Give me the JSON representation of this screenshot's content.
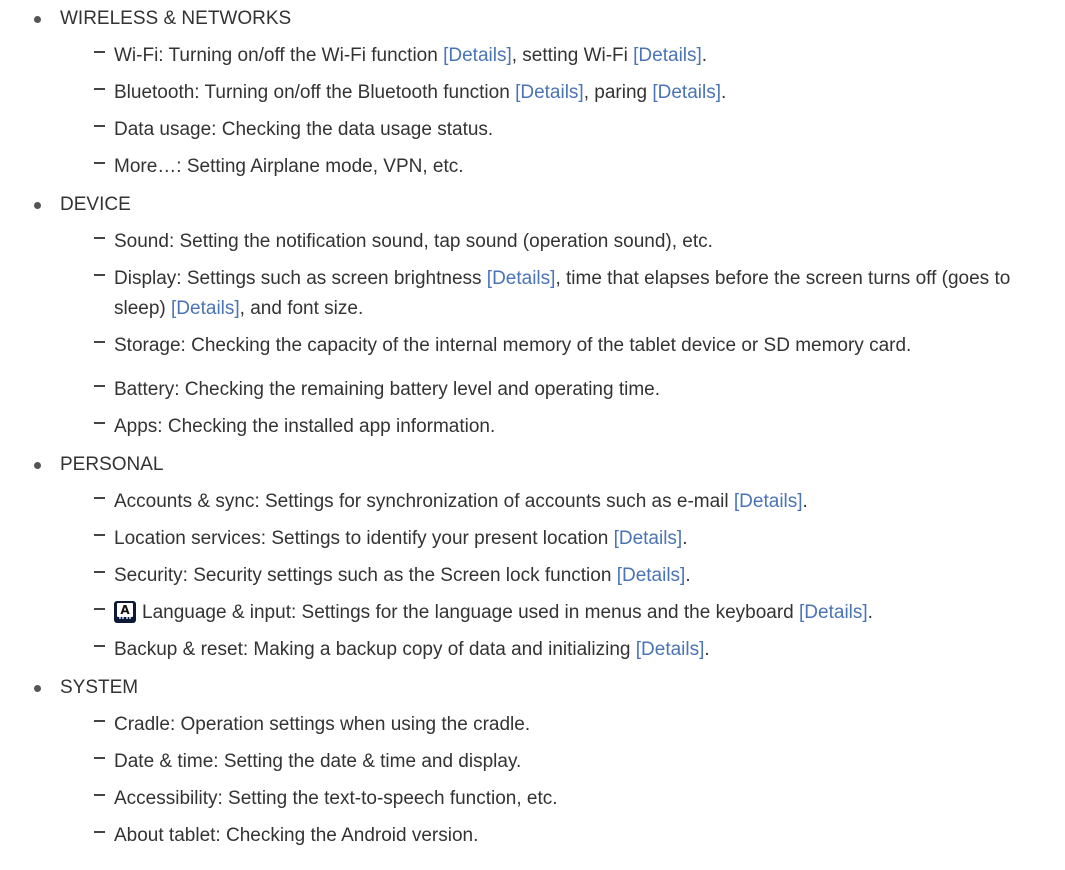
{
  "colors": {
    "link": "#4a74b5",
    "text": "#333333"
  },
  "sections": [
    {
      "title": "WIRELESS & NETWORKS",
      "items": [
        {
          "text": "Wi-Fi: Turning on/off the Wi-Fi function ",
          "link1": "[Details]",
          "mid": ", setting Wi-Fi ",
          "link2": "[Details]",
          "end": "."
        },
        {
          "text": "Bluetooth: Turning on/off the Bluetooth function ",
          "link1": "[Details]",
          "mid": ", paring ",
          "link2": "[Details]",
          "end": "."
        },
        {
          "text": "Data usage: Checking the data usage status."
        },
        {
          "text": "More…: Setting Airplane mode, VPN, etc."
        }
      ]
    },
    {
      "title": "DEVICE",
      "items": [
        {
          "text": "Sound: Setting the notification sound, tap sound (operation sound), etc."
        },
        {
          "text": "Display: Settings such as screen brightness ",
          "link1": "[Details]",
          "mid": ", time that elapses before the screen turns off (goes to sleep) ",
          "link2": "[Details]",
          "end": ", and font size."
        },
        {
          "text": "Storage: Checking the capacity of the internal memory of the tablet device or SD memory card."
        },
        {
          "text": "Battery: Checking the remaining battery level and operating time."
        },
        {
          "text": "Apps: Checking the installed app information."
        }
      ]
    },
    {
      "title": "PERSONAL",
      "items": [
        {
          "text": "Accounts & sync: Settings for synchronization of accounts such as e-mail ",
          "link1": "[Details]",
          "end": "."
        },
        {
          "text": "Location services: Settings to identify your present location ",
          "link1": "[Details]",
          "end": "."
        },
        {
          "text": "Security: Security settings such as the Screen lock function ",
          "link1": "[Details]",
          "end": "."
        },
        {
          "icon": "language-input-icon",
          "icon_letter": "A",
          "text": "Language & input: Settings for the language used in menus and the keyboard ",
          "link1": "[Details]",
          "end": "."
        },
        {
          "text": "Backup & reset: Making a backup copy of data and initializing ",
          "link1": "[Details]",
          "end": "."
        }
      ]
    },
    {
      "title": "SYSTEM",
      "items": [
        {
          "text": "Cradle: Operation settings when using the cradle."
        },
        {
          "text": "Date & time: Setting the date & time and display."
        },
        {
          "text": "Accessibility: Setting the text-to-speech function, etc."
        },
        {
          "text": "About tablet: Checking the Android version."
        }
      ]
    }
  ]
}
